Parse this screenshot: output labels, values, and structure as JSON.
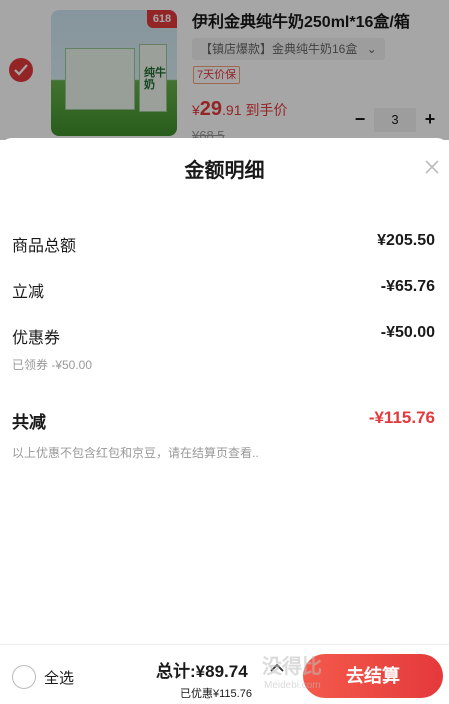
{
  "product": {
    "badge": "618",
    "title": "伊利金典纯牛奶250ml*16盒/箱",
    "spec": "【镇店爆款】金典纯牛奶16盒",
    "spec_arrow": "⌄",
    "tag": "7天价保",
    "price_symbol": "¥",
    "price_int": "29",
    "price_dec": ".91",
    "price_suffix": "到手价",
    "old_price": "¥68.5",
    "qty": "3",
    "minus": "−",
    "plus": "+",
    "box_label": "纯牛奶",
    "checked": true
  },
  "sheet": {
    "title": "金额明细",
    "rows": [
      {
        "label": "商品总额",
        "value": "¥205.50"
      },
      {
        "label": "立减",
        "value": "-¥65.76"
      },
      {
        "label": "优惠券",
        "value": "-¥50.00"
      }
    ],
    "coupon_note": "已领券 -¥50.00",
    "total_label": "共减",
    "total_value": "-¥115.76",
    "footnote": "以上优惠不包含红包和京豆，请在结算页查看.."
  },
  "bottom": {
    "select_all": "全选",
    "sum": "总计:¥89.74",
    "saved": "已优惠¥115.76",
    "checkout": "去结算"
  },
  "watermark": {
    "text": "没得比",
    "sub": "Meidebi.com"
  },
  "colors": {
    "accent": "#e4393c",
    "muted": "#999999"
  },
  "icons": {
    "close": "close-icon",
    "check": "check-icon",
    "chevron_up": "chevron-up-icon"
  }
}
